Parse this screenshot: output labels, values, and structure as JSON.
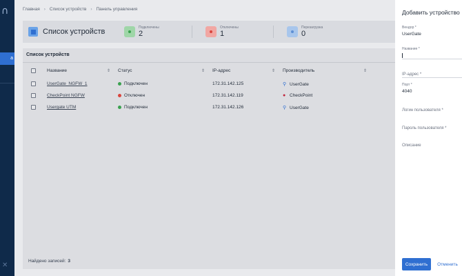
{
  "sidebar": {
    "active_label": "a"
  },
  "breadcrumb": [
    "Главная",
    "Список устройств",
    "Панель управления"
  ],
  "header": {
    "title": "Список устройств",
    "stats": [
      {
        "label": "Подключены",
        "value": "2",
        "bg": "#9fd6a8",
        "dot": "#3aa14f"
      },
      {
        "label": "Отключены",
        "value": "1",
        "bg": "#f1a7a3",
        "dot": "#d9453d"
      },
      {
        "label": "Перезагрузка",
        "value": "0",
        "bg": "#a8c6ec",
        "dot": "#5e8fd4"
      }
    ]
  },
  "table": {
    "title": "Список устройств",
    "columns": [
      "Название",
      "Статус",
      "IP-адрес",
      "Производитель"
    ],
    "rows": [
      {
        "name": "UserGate_NGFW_1",
        "status": "Подключен",
        "status_color": "#3aa14f",
        "ip": "172.31.142.125",
        "vendor": "UserGate",
        "vendor_icon": "usergate-icon"
      },
      {
        "name": "CheckPoint NGFW",
        "status": "Отключен",
        "status_color": "#d9453d",
        "ip": "172.31.142.119",
        "vendor": "CheckPoint",
        "vendor_icon": "checkpoint-icon"
      },
      {
        "name": "Usergate UTM",
        "status": "Подключен",
        "status_color": "#3aa14f",
        "ip": "172.31.142.126",
        "vendor": "UserGate",
        "vendor_icon": "usergate-icon"
      }
    ],
    "footer_label": "Найдено записей:",
    "footer_count": "3"
  },
  "drawer": {
    "title": "Добавить устройство",
    "fields": {
      "vendor": {
        "label": "Вендор *",
        "value": "UserGate"
      },
      "name": {
        "label": "Название *",
        "value": ""
      },
      "ip": {
        "label": "IP-адрес *",
        "value": ""
      },
      "port": {
        "label": "Порт *",
        "value": "4040"
      },
      "login": {
        "label": "Логин пользователя *",
        "value": ""
      },
      "password": {
        "label": "Пароль пользователя *",
        "value": ""
      },
      "description": {
        "label": "Описание",
        "value": ""
      }
    },
    "save_label": "Сохранить",
    "cancel_label": "Отменить"
  },
  "colors": {
    "accent": "#2f6fd1",
    "sidebar": "#0f2a4a"
  }
}
